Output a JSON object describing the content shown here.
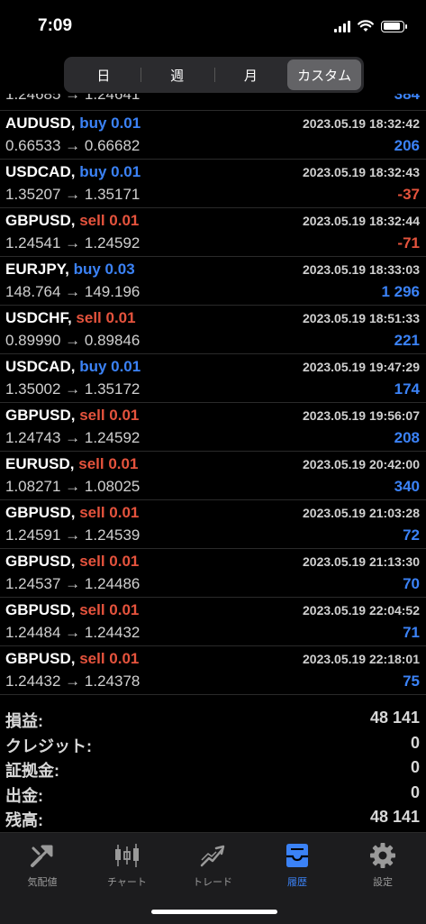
{
  "status_bar": {
    "time": "7:09",
    "battery_level": 0.9
  },
  "segmented": {
    "tabs": [
      "日",
      "週",
      "月",
      "カスタム"
    ],
    "active_index": 3
  },
  "partial_row": {
    "prices": "1.24685 → 1.24641",
    "profit": "384"
  },
  "trades": [
    {
      "pair": "AUDUSD,",
      "side": "buy",
      "volume": "buy 0.01",
      "time": "2023.05.19 18:32:42",
      "prices": "0.66533 → 0.66682",
      "profit": "206",
      "sign": "pos"
    },
    {
      "pair": "USDCAD,",
      "side": "buy",
      "volume": "buy 0.01",
      "time": "2023.05.19 18:32:43",
      "prices": "1.35207 → 1.35171",
      "profit": "-37",
      "sign": "neg"
    },
    {
      "pair": "GBPUSD,",
      "side": "sell",
      "volume": "sell 0.01",
      "time": "2023.05.19 18:32:44",
      "prices": "1.24541 → 1.24592",
      "profit": "-71",
      "sign": "neg"
    },
    {
      "pair": "EURJPY,",
      "side": "buy",
      "volume": "buy 0.03",
      "time": "2023.05.19 18:33:03",
      "prices": "148.764 → 149.196",
      "profit": "1 296",
      "sign": "pos"
    },
    {
      "pair": "USDCHF,",
      "side": "sell",
      "volume": "sell 0.01",
      "time": "2023.05.19 18:51:33",
      "prices": "0.89990 → 0.89846",
      "profit": "221",
      "sign": "pos"
    },
    {
      "pair": "USDCAD,",
      "side": "buy",
      "volume": "buy 0.01",
      "time": "2023.05.19 19:47:29",
      "prices": "1.35002 → 1.35172",
      "profit": "174",
      "sign": "pos"
    },
    {
      "pair": "GBPUSD,",
      "side": "sell",
      "volume": "sell 0.01",
      "time": "2023.05.19 19:56:07",
      "prices": "1.24743 → 1.24592",
      "profit": "208",
      "sign": "pos"
    },
    {
      "pair": "EURUSD,",
      "side": "sell",
      "volume": "sell 0.01",
      "time": "2023.05.19 20:42:00",
      "prices": "1.08271 → 1.08025",
      "profit": "340",
      "sign": "pos"
    },
    {
      "pair": "GBPUSD,",
      "side": "sell",
      "volume": "sell 0.01",
      "time": "2023.05.19 21:03:28",
      "prices": "1.24591 → 1.24539",
      "profit": "72",
      "sign": "pos"
    },
    {
      "pair": "GBPUSD,",
      "side": "sell",
      "volume": "sell 0.01",
      "time": "2023.05.19 21:13:30",
      "prices": "1.24537 → 1.24486",
      "profit": "70",
      "sign": "pos"
    },
    {
      "pair": "GBPUSD,",
      "side": "sell",
      "volume": "sell 0.01",
      "time": "2023.05.19 22:04:52",
      "prices": "1.24484 → 1.24432",
      "profit": "71",
      "sign": "pos"
    },
    {
      "pair": "GBPUSD,",
      "side": "sell",
      "volume": "sell 0.01",
      "time": "2023.05.19 22:18:01",
      "prices": "1.24432 → 1.24378",
      "profit": "75",
      "sign": "pos"
    }
  ],
  "summary": [
    {
      "label": "損益:",
      "value": "48 141"
    },
    {
      "label": "クレジット:",
      "value": "0"
    },
    {
      "label": "証拠金:",
      "value": "0"
    },
    {
      "label": "出金:",
      "value": "0"
    },
    {
      "label": "残高:",
      "value": "48 141"
    }
  ],
  "tabbar": {
    "items": [
      {
        "label": "気配値",
        "icon": "quotes-icon"
      },
      {
        "label": "チャート",
        "icon": "candlestick-chart-icon"
      },
      {
        "label": "トレード",
        "icon": "trade-icon"
      },
      {
        "label": "履歴",
        "icon": "history-inbox-icon"
      },
      {
        "label": "設定",
        "icon": "gear-icon"
      }
    ],
    "active_index": 3
  },
  "colors": {
    "buy": "#3b82f6",
    "sell": "#e5533d",
    "accent": "#3b82f6",
    "background": "#000000"
  }
}
